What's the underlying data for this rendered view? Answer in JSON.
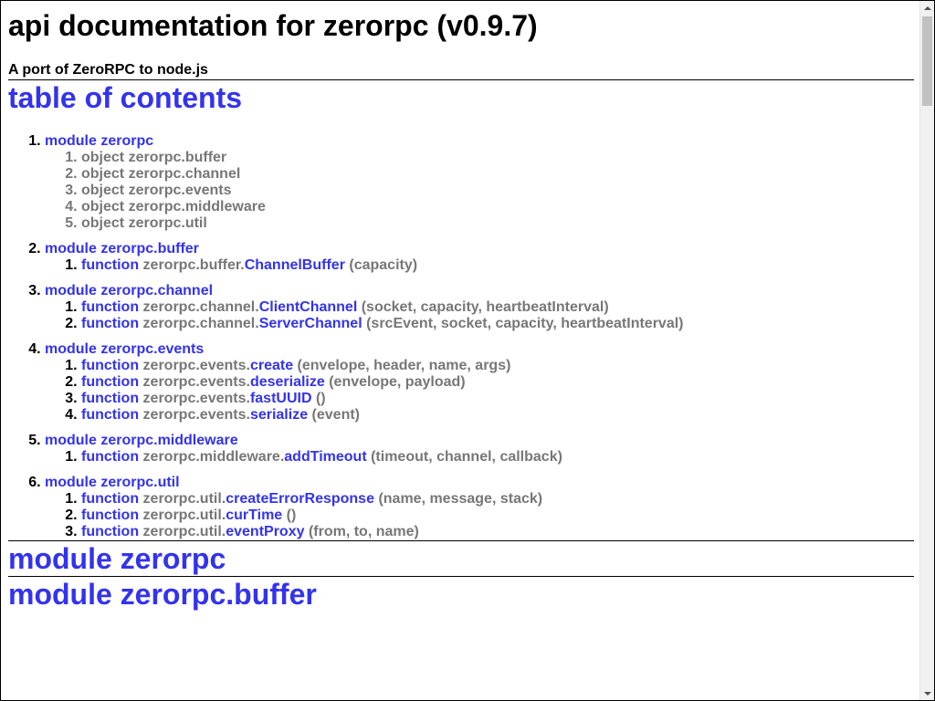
{
  "header": {
    "title": "api documentation for zerorpc (v0.9.7)",
    "subtitle": "A port of ZeroRPC to node.js"
  },
  "toc": {
    "title": "table of contents",
    "modules": [
      {
        "label": "module zerorpc",
        "items": [
          {
            "kind": "object",
            "prefix": "zerorpc.buffer",
            "name": "",
            "args": ""
          },
          {
            "kind": "object",
            "prefix": "zerorpc.channel",
            "name": "",
            "args": ""
          },
          {
            "kind": "object",
            "prefix": "zerorpc.events",
            "name": "",
            "args": ""
          },
          {
            "kind": "object",
            "prefix": "zerorpc.middleware",
            "name": "",
            "args": ""
          },
          {
            "kind": "object",
            "prefix": "zerorpc.util",
            "name": "",
            "args": ""
          }
        ]
      },
      {
        "label": "module zerorpc.buffer",
        "items": [
          {
            "kind": "function",
            "prefix": "zerorpc.buffer.",
            "name": "ChannelBuffer",
            "args": "(capacity)"
          }
        ]
      },
      {
        "label": "module zerorpc.channel",
        "items": [
          {
            "kind": "function",
            "prefix": "zerorpc.channel.",
            "name": "ClientChannel",
            "args": "(socket, capacity, heartbeatInterval)"
          },
          {
            "kind": "function",
            "prefix": "zerorpc.channel.",
            "name": "ServerChannel",
            "args": "(srcEvent, socket, capacity, heartbeatInterval)"
          }
        ]
      },
      {
        "label": "module zerorpc.events",
        "items": [
          {
            "kind": "function",
            "prefix": "zerorpc.events.",
            "name": "create",
            "args": "(envelope, header, name, args)"
          },
          {
            "kind": "function",
            "prefix": "zerorpc.events.",
            "name": "deserialize",
            "args": "(envelope, payload)"
          },
          {
            "kind": "function",
            "prefix": "zerorpc.events.",
            "name": "fastUUID",
            "args": "()"
          },
          {
            "kind": "function",
            "prefix": "zerorpc.events.",
            "name": "serialize",
            "args": "(event)"
          }
        ]
      },
      {
        "label": "module zerorpc.middleware",
        "items": [
          {
            "kind": "function",
            "prefix": "zerorpc.middleware.",
            "name": "addTimeout",
            "args": "(timeout, channel, callback)"
          }
        ]
      },
      {
        "label": "module zerorpc.util",
        "items": [
          {
            "kind": "function",
            "prefix": "zerorpc.util.",
            "name": "createErrorResponse",
            "args": "(name, message, stack)"
          },
          {
            "kind": "function",
            "prefix": "zerorpc.util.",
            "name": "curTime",
            "args": "()"
          },
          {
            "kind": "function",
            "prefix": "zerorpc.util.",
            "name": "eventProxy",
            "args": "(from, to, name)"
          }
        ]
      }
    ]
  },
  "sections": [
    {
      "title": "module zerorpc"
    },
    {
      "title": "module zerorpc.buffer"
    }
  ],
  "colors": {
    "link": "#3333ee",
    "muted": "#777777",
    "text": "#000000"
  }
}
